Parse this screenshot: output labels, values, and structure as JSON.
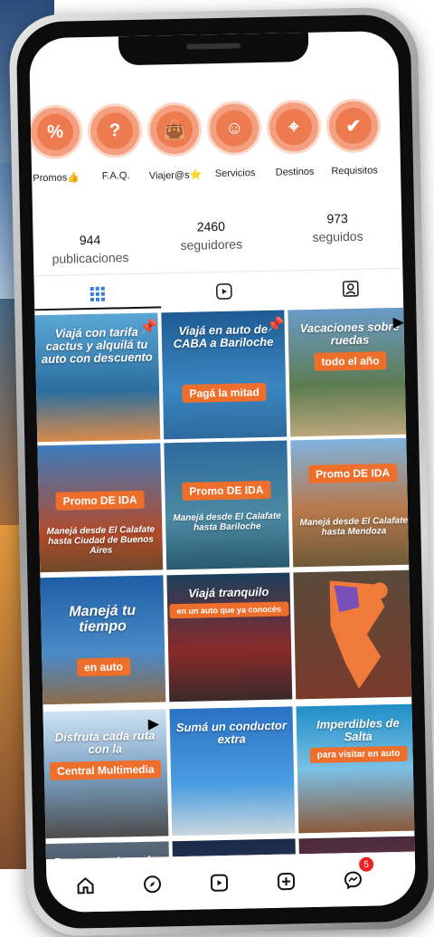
{
  "highlights": [
    {
      "label": "Promos👍",
      "icon": "ticket-percent-icon",
      "glyph": "%"
    },
    {
      "label": "F.A.Q.",
      "icon": "question-icon",
      "glyph": "?"
    },
    {
      "label": "Viajer@s⭐",
      "icon": "shopping-bag-icon",
      "glyph": "👜"
    },
    {
      "label": "Servicios",
      "icon": "smile-icon",
      "glyph": "☺"
    },
    {
      "label": "Destinos",
      "icon": "location-chat-icon",
      "glyph": "⌖"
    },
    {
      "label": "Requisitos",
      "icon": "checkmark-icon",
      "glyph": "✔"
    }
  ],
  "stats": {
    "posts_count": "944",
    "posts_label": "publicaciones",
    "followers_count": "2460",
    "followers_label": "seguidores",
    "following_count": "973",
    "following_label": "seguidos"
  },
  "posts": [
    {
      "caption": "Viajá con tarifa cactus y alquilá tu auto con descuento",
      "badge": ""
    },
    {
      "caption": "Viajá en auto de CABA a Bariloche",
      "badge": "Pagá la mitad"
    },
    {
      "caption": "Vacaciones sobre ruedas",
      "badge": "todo el año"
    },
    {
      "caption": "Manejá desde El Calafate hasta Ciudad de Buenos Aires",
      "badge": "Promo DE IDA"
    },
    {
      "caption": "Manejá desde El Calafate hasta Bariloche",
      "badge": "Promo DE IDA"
    },
    {
      "caption": "Manejá desde El Calafate hasta Mendoza",
      "badge": "Promo DE IDA"
    },
    {
      "caption": "Manejá tu tiempo",
      "badge": "en auto"
    },
    {
      "caption": "Viajá tranquilo",
      "badge": "en un auto que ya conocés"
    },
    {
      "caption": "",
      "badge": ""
    },
    {
      "caption": "Disfrutá cada ruta con la",
      "badge": "Central Multimedia"
    },
    {
      "caption": "Sumá un conductor extra",
      "badge": ""
    },
    {
      "caption": "Imperdibles de Salta",
      "badge": "para visitar en auto"
    },
    {
      "caption": "Buscamos Lavador",
      "badge": ""
    },
    {
      "caption": "",
      "badge": ""
    },
    {
      "caption": "",
      "badge": ""
    }
  ],
  "notifications": "5",
  "colors": {
    "accent": "#ee7a4f",
    "promo_orange": "#ee6f2c"
  }
}
